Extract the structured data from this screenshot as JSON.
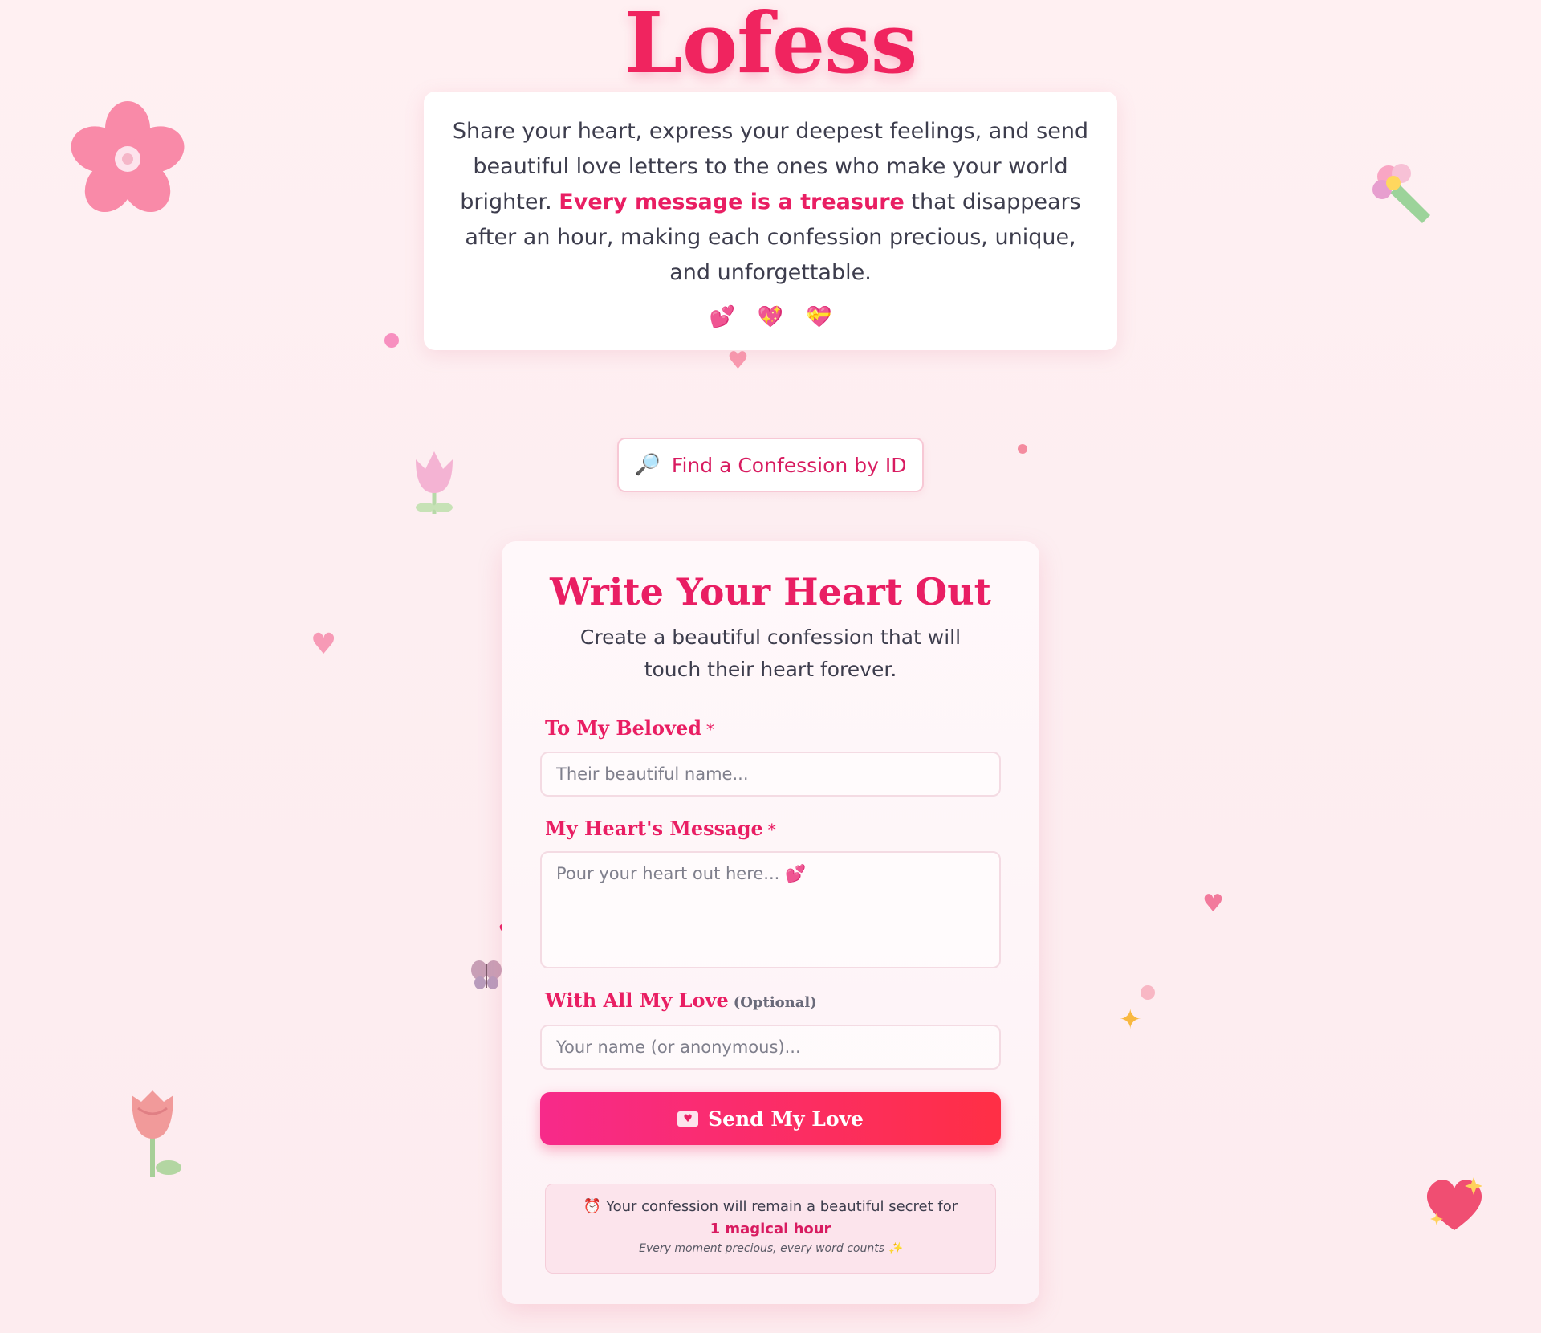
{
  "app": {
    "title": "Lofess"
  },
  "intro": {
    "text_before": "Share your heart, express your deepest feelings, and send beautiful love letters to the ones who make your world brighter.",
    "highlight": "Every message is a treasure",
    "text_after": "that disappears after an hour, making each confession precious, unique, and unforgettable.",
    "hearts": [
      "💕",
      "💖",
      "💝"
    ]
  },
  "find": {
    "icon": "🔎",
    "label": "Find a Confession by ID"
  },
  "form": {
    "title": "Write Your Heart Out",
    "subtitle": "Create a beautiful confession that will touch their heart forever.",
    "beloved": {
      "label": "To My Beloved",
      "required": "*",
      "placeholder": "Their beautiful name..."
    },
    "message": {
      "label": "My Heart's Message",
      "required": "*",
      "placeholder": "Pour your heart out here... 💕"
    },
    "signature": {
      "label": "With All My Love",
      "optional": "(Optional)",
      "placeholder": "Your name (or anonymous)..."
    },
    "submit": {
      "icon": "💌",
      "label": "Send My Love"
    },
    "note": {
      "icon": "⏰",
      "text": "Your confession will remain a beautiful secret for",
      "highlight": "1 magical hour",
      "subtext": "Every moment precious, every word counts ✨"
    }
  },
  "colors": {
    "accent": "#e91e63",
    "button_start": "#f72a8a",
    "button_end": "#ff2f45",
    "background": "#fdeef1"
  },
  "decorations": [
    "cherry-blossom-icon",
    "bouquet-icon",
    "tulip-icon",
    "heart-icon",
    "butterfly-icon",
    "sparkles-icon",
    "rose-icon",
    "sparkling-heart-icon"
  ]
}
